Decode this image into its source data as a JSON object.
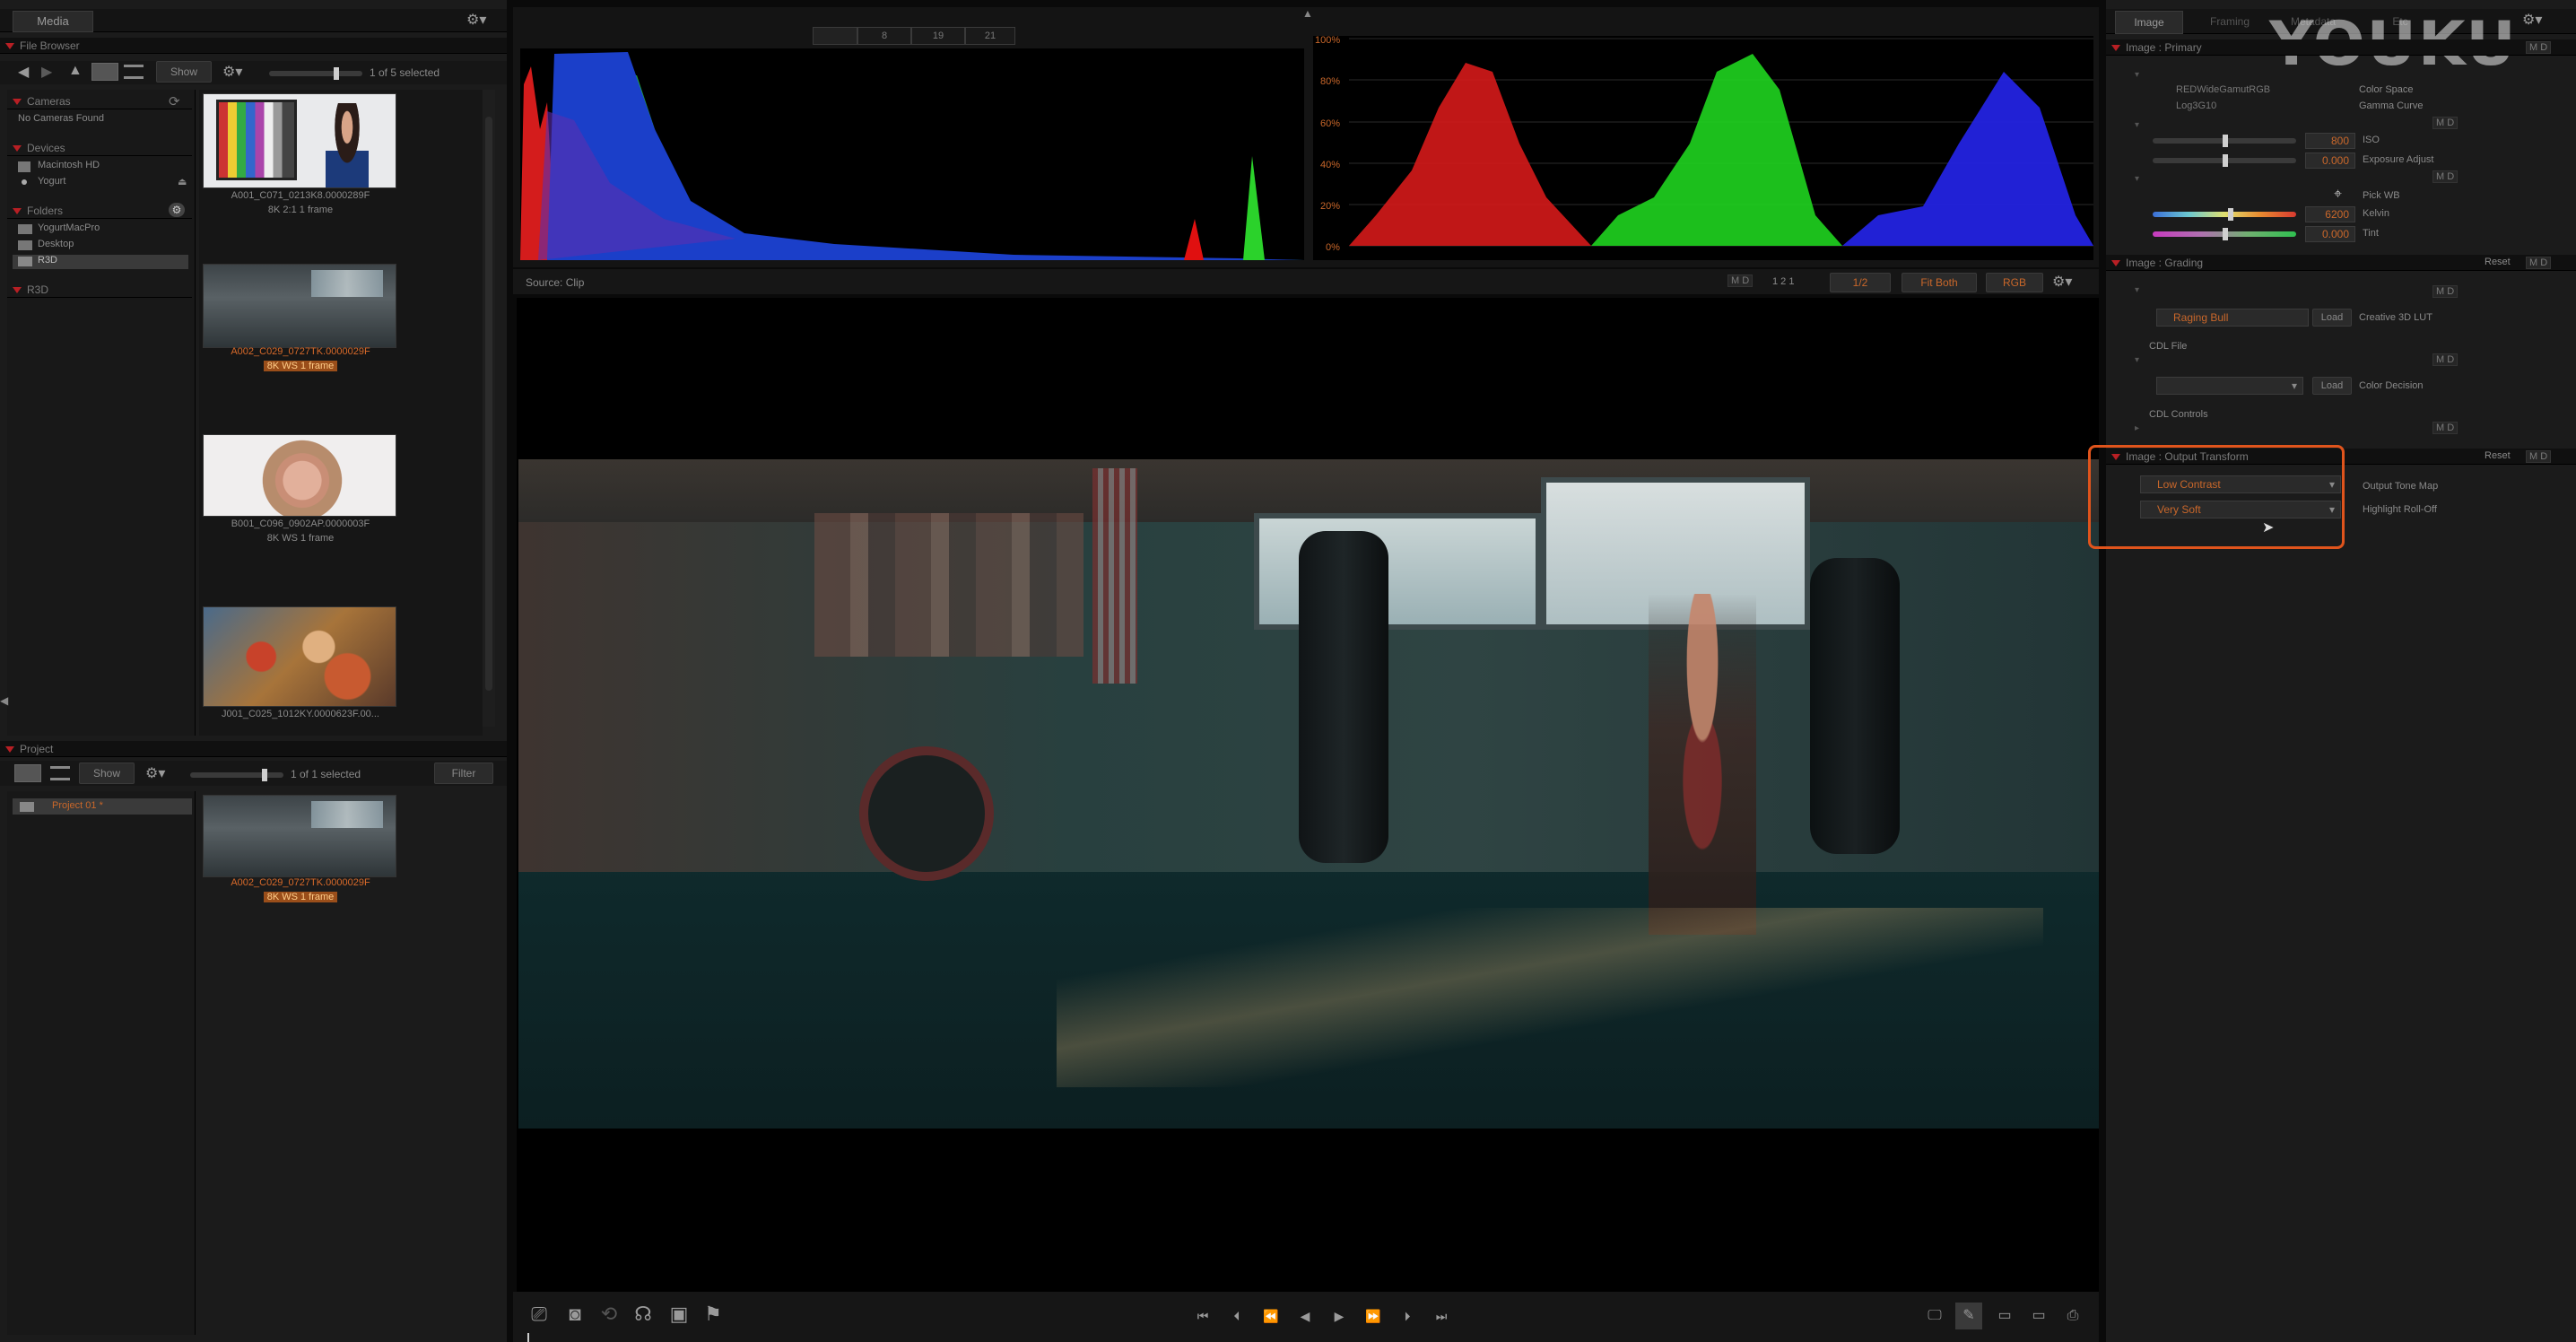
{
  "watermark": "YOUKU",
  "left_panel": {
    "media_tab": "Media",
    "file_browser_header": "File Browser",
    "show_btn": "Show",
    "selection_count": "1 of 5 selected",
    "sections": {
      "cameras": "Cameras",
      "no_cameras": "No Cameras Found",
      "devices": "Devices",
      "device_items": [
        "Macintosh HD",
        "Yogurt"
      ],
      "folders": "Folders",
      "folder_items": [
        "YogurtMacPro",
        "Desktop",
        "R3D"
      ],
      "r3d": "R3D"
    },
    "thumbnails": [
      {
        "name": "A001_C071_0213K8.0000289F",
        "meta": "8K 2:1  1 frame",
        "selected": false
      },
      {
        "name": "A002_C029_0727TK.0000029F",
        "meta": "8K WS   1 frame",
        "selected": true
      },
      {
        "name": "B001_C096_0902AP.0000003F",
        "meta": "8K WS   1 frame",
        "selected": false
      },
      {
        "name": "J001_C025_1012KY.0000623F.00...",
        "meta": "",
        "selected": false
      }
    ]
  },
  "project_panel": {
    "header": "Project",
    "show_btn": "Show",
    "selection_count": "1 of 1 selected",
    "filter_btn": "Filter",
    "project_item": "Project 01 *",
    "thumbnail": {
      "name": "A002_C029_0727TK.0000029F",
      "meta": "8K WS   1 frame"
    }
  },
  "scopes": {
    "timecode_fields": [
      "",
      "8",
      "19",
      "21"
    ],
    "parade_labels": [
      "100%",
      "80%",
      "60%",
      "40%",
      "20%",
      "0%"
    ]
  },
  "viewer": {
    "source_label": "Source: Clip",
    "md_label": "M D",
    "page_indicator": "1  2  1",
    "zoom": "1/2",
    "fit": "Fit Both",
    "channel": "RGB"
  },
  "right_panel": {
    "tabs": [
      "Image",
      "Framing",
      "Metadata",
      "Etc"
    ],
    "primary": {
      "header": "Image : Primary",
      "color_space_value": "REDWideGamutRGB",
      "color_space_label": "Color Space",
      "gamma_value": "Log3G10",
      "gamma_label": "Gamma Curve",
      "iso_value": "800",
      "iso_label": "ISO",
      "exposure_value": "0.000",
      "exposure_label": "Exposure Adjust",
      "pick_wb": "Pick WB",
      "kelvin_value": "6200",
      "kelvin_label": "Kelvin",
      "tint_value": "0.000",
      "tint_label": "Tint",
      "md": "M D"
    },
    "grading": {
      "header": "Image : Grading",
      "reset": "Reset",
      "lut_value": "Raging Bull",
      "load_btn": "Load",
      "lut_label": "Creative 3D LUT",
      "cdl_file": "CDL File",
      "cdl_load": "Load",
      "color_decision": "Color Decision",
      "cdl_controls": "CDL Controls"
    },
    "output_transform": {
      "header": "Image : Output Transform",
      "reset": "Reset",
      "tone_map_value": "Low Contrast",
      "tone_map_label": "Output Tone Map",
      "rolloff_value": "Very Soft",
      "rolloff_label": "Highlight Roll-Off",
      "highlight_color": "#e0541c"
    }
  }
}
